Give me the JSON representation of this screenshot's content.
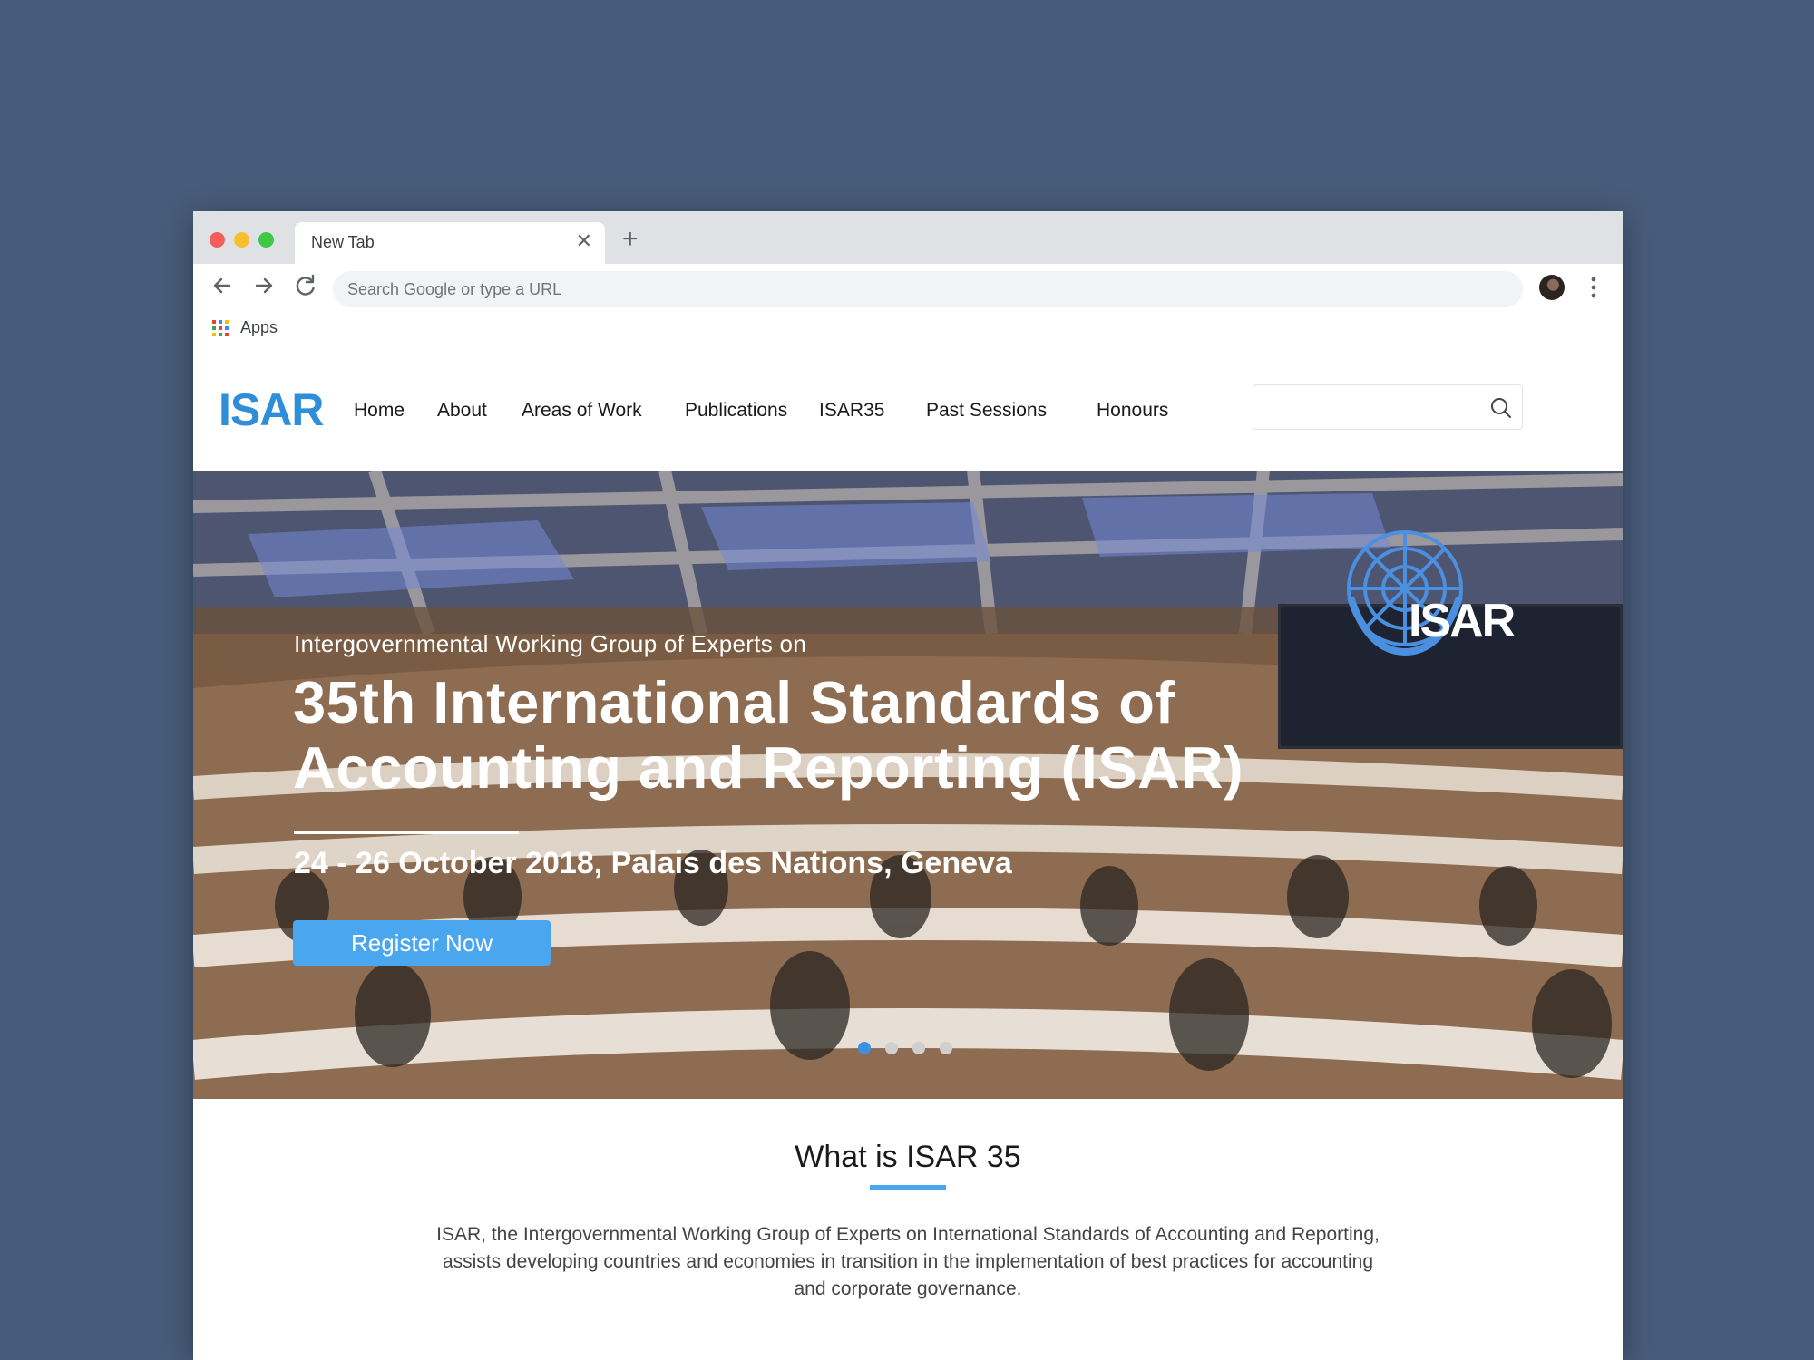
{
  "browser": {
    "tab_title": "New Tab",
    "omnibox_placeholder": "Search Google or type a URL",
    "bookmark_apps": "Apps"
  },
  "site": {
    "logo": "ISAR",
    "nav": [
      "Home",
      "About",
      "Areas of Work",
      "Publications",
      "ISAR35",
      "Past Sessions",
      "Honours"
    ]
  },
  "hero": {
    "seal_text": "ISAR",
    "kicker": "Intergovernmental Working Group of Experts on",
    "title": "35th International Standards of Accounting and Reporting (ISAR)",
    "date_venue": "24 - 26 October 2018, Palais des Nations, Geneva",
    "cta": "Register Now",
    "carousel_count": 4,
    "carousel_active": 1
  },
  "about": {
    "title": "What is ISAR 35",
    "text": "ISAR, the Intergovernmental Working Group of Experts on International Standards of Accounting and Reporting, assists developing countries and economies in transition in the implementation of best practices for accounting and corporate governance."
  },
  "colors": {
    "page_bg": "#475c7a",
    "brand_blue": "#2e8fd8",
    "cta_blue": "#4aa6ef"
  }
}
